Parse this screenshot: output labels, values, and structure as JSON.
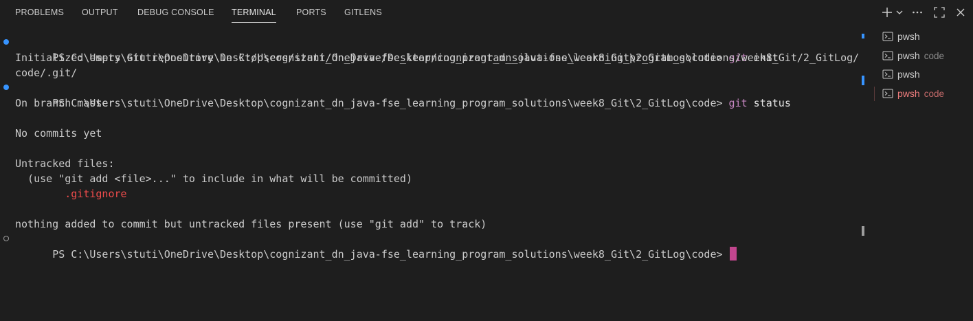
{
  "tabs": [
    {
      "label": "PROBLEMS"
    },
    {
      "label": "OUTPUT"
    },
    {
      "label": "DEBUG CONSOLE"
    },
    {
      "label": "TERMINAL"
    },
    {
      "label": "PORTS"
    },
    {
      "label": "GITLENS"
    }
  ],
  "active_tab": "TERMINAL",
  "actions": {
    "icons": [
      "plus-icon",
      "chevron-down-icon",
      "ellipsis-icon",
      "maximize-icon",
      "close-icon"
    ]
  },
  "terminal": {
    "prompt": "PS C:\\Users\\stuti\\OneDrive\\Desktop\\cognizant_dn_java-fse_learning_program_solutions\\week8_Git\\2_GitLog\\code> ",
    "cmd1": {
      "git": "git",
      "rest": " init"
    },
    "init_out_1": "Initialized empty Git repository in C:/Users/stuti/OneDrive/Desktop/cognizant_dn_java-fse_learning_program_solutions/week8_Git/2_GitLog/",
    "init_out_2": "code/.git/",
    "cmd2": {
      "git": "git",
      "rest": " status"
    },
    "status_lines": {
      "branch": "On branch master",
      "no_commits": "No commits yet",
      "untracked_header": "Untracked files:",
      "hint": "  (use \"git add <file>...\" to include in what will be committed)",
      "file": "        .gitignore",
      "summary": "nothing added to commit but untracked files present (use \"git add\" to track)"
    }
  },
  "colors": {
    "background": "#1e1e1e",
    "command": "#c586c0",
    "untracked_file": "#f14c4c",
    "cursor": "#c2468e",
    "decoration_success": "#3794ff",
    "active_terminal": "#ee7d7d"
  },
  "terminal_list": [
    {
      "name": "pwsh",
      "desc": "",
      "icon": "terminal-icon"
    },
    {
      "name": "pwsh",
      "desc": "code",
      "icon": "terminal-icon"
    },
    {
      "name": "pwsh",
      "desc": "",
      "icon": "terminal-icon"
    },
    {
      "name": "pwsh",
      "desc": "code",
      "icon": "terminal-icon",
      "active": true
    }
  ]
}
